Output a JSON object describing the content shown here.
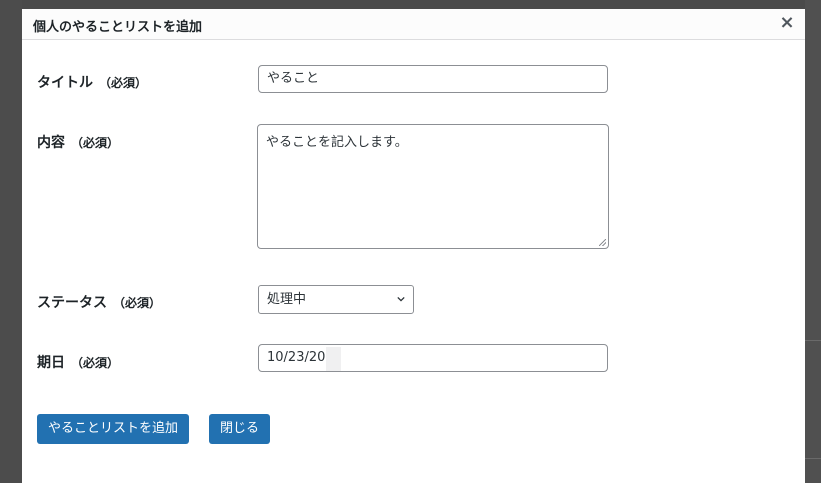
{
  "dialog": {
    "title": "個人のやることリストを追加",
    "close_icon": "×"
  },
  "form": {
    "title": {
      "label": "タイトル",
      "required": "（必須）",
      "value": "やること"
    },
    "content": {
      "label": "内容",
      "required": "（必須）",
      "value": "やることを記入します。"
    },
    "status": {
      "label": "ステータス",
      "required": "（必須）",
      "selected": "処理中"
    },
    "due_date": {
      "label": "期日",
      "required": "（必須）",
      "value": "10/23/20"
    }
  },
  "buttons": {
    "add": "やることリストを追加",
    "close": "閉じる"
  },
  "colors": {
    "primary": "#2271b1",
    "border": "#8c8f94",
    "text": "#1d2327"
  },
  "icons": {
    "close": "close-icon",
    "dropdown": "chevron-down-icon"
  }
}
